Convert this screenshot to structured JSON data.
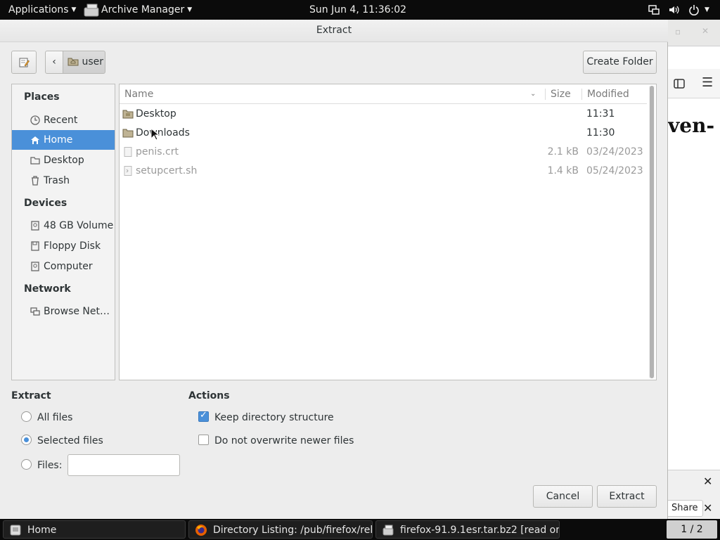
{
  "topbar": {
    "applications_label": "Applications",
    "app_label": "Archive Manager",
    "clock": "Sun Jun  4, 11:36:02"
  },
  "dialog": {
    "title": "Extract",
    "breadcrumb_folder": "user",
    "create_folder_label": "Create Folder"
  },
  "sidebar": {
    "places_heading": "Places",
    "places": [
      "Recent",
      "Home",
      "Desktop",
      "Trash"
    ],
    "selected": "Home",
    "devices_heading": "Devices",
    "devices": [
      "48 GB Volume",
      "Floppy Disk",
      "Computer"
    ],
    "network_heading": "Network",
    "network": [
      "Browse Net…"
    ]
  },
  "filelist": {
    "columns": {
      "name": "Name",
      "size": "Size",
      "modified": "Modified"
    },
    "rows": [
      {
        "name": "Desktop",
        "size": "",
        "modified": "11:31",
        "type": "folder"
      },
      {
        "name": "Downloads",
        "size": "",
        "modified": "11:30",
        "type": "folder"
      },
      {
        "name": "penis.crt",
        "size": "2.1 kB",
        "modified": "03/24/2023",
        "type": "file"
      },
      {
        "name": "setupcert.sh",
        "size": "1.4 kB",
        "modified": "05/24/2023",
        "type": "script"
      }
    ]
  },
  "extract_section": {
    "label": "Extract",
    "all_files": "All files",
    "selected_files": "Selected files",
    "files": "Files:",
    "files_value": "",
    "selected_option": "selected_files"
  },
  "actions_section": {
    "label": "Actions",
    "keep_structure": "Keep directory structure",
    "keep_structure_checked": true,
    "no_overwrite": "Do not overwrite newer files",
    "no_overwrite_checked": false
  },
  "buttons": {
    "cancel": "Cancel",
    "extract": "Extract"
  },
  "background_window": {
    "heading_fragment": "ven-",
    "share_label": "Share"
  },
  "taskbar": {
    "tasks": [
      "Home",
      "Directory Listing: /pub/firefox/rel…",
      "firefox-91.9.1esr.tar.bz2 [read on…"
    ],
    "pager": "1 / 2"
  },
  "colors": {
    "accent": "#4a90d9",
    "panel": "#0b0b0b",
    "dialog_bg": "#ededed"
  }
}
